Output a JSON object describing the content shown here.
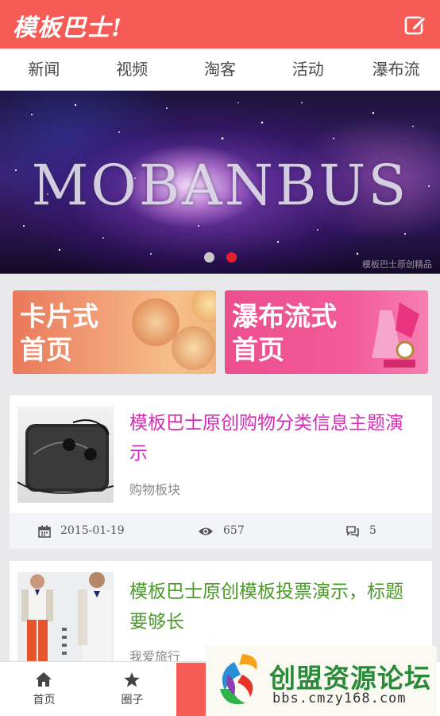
{
  "header": {
    "logo": "模板巴士!"
  },
  "tabs": [
    "新闻",
    "视频",
    "淘客",
    "活动",
    "瀑布流"
  ],
  "banner": {
    "title": "MOBANBUS",
    "watermark": "模板巴士原创精品",
    "dots": 2,
    "active_dot": 2
  },
  "cards": [
    {
      "line1": "卡片式",
      "line2": "首页"
    },
    {
      "line1": "瀑布流式",
      "line2": "首页"
    }
  ],
  "posts": [
    {
      "title": "模板巴士原创购物分类信息主题演示",
      "category": "购物板块",
      "date": "2015-01-19",
      "views": "657",
      "comments": "5",
      "title_color": "#d62bb6"
    },
    {
      "title": "模板巴士原创模板投票演示，标题要够长",
      "category": "我爱旅行",
      "title_color": "#4a9a28"
    }
  ],
  "bottom_nav": [
    {
      "label": "首页",
      "icon": "home-icon"
    },
    {
      "label": "圈子",
      "icon": "star-icon"
    }
  ],
  "ad": {
    "text": "创盟资源论坛",
    "url": "bbs.cmzy168.com"
  },
  "colors": {
    "primary": "#f65c55",
    "active_dot": "#e81d2b",
    "post1_title": "#d62bb6",
    "post2_title": "#4a9a28"
  }
}
